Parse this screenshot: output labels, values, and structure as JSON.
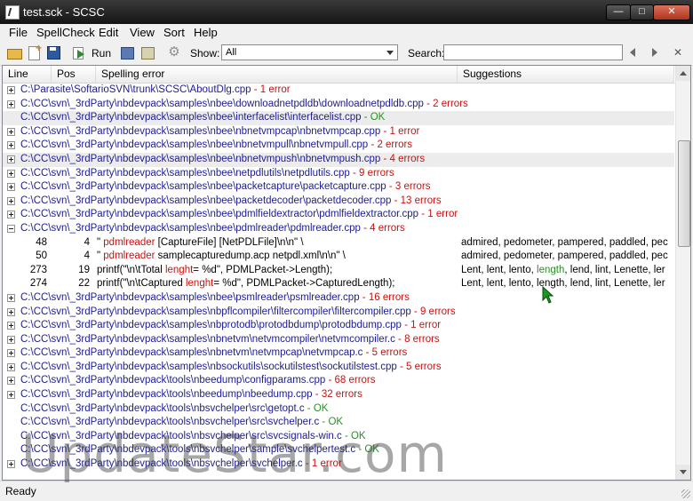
{
  "window": {
    "title": "test.sck - SCSC"
  },
  "menu": [
    "File",
    "SpellCheck",
    "Edit",
    "View",
    "Sort",
    "Help"
  ],
  "toolbar": {
    "run_label": "Run",
    "show_label": "Show:",
    "show_value": "All",
    "search_label": "Search:",
    "search_value": ""
  },
  "columns": {
    "line": "Line",
    "pos": "Pos",
    "error": "Spelling error",
    "suggestions": "Suggestions"
  },
  "rows": [
    {
      "kind": "file",
      "expander": "plus",
      "path": "C:\\Parasite\\SoftarioSVN\\trunk\\SCSC\\AboutDlg.cpp",
      "status": " - 1 error",
      "ok": false
    },
    {
      "kind": "file",
      "expander": "plus",
      "path": "C:\\CC\\svn\\_3rdParty\\nbdevpack\\samples\\nbee\\downloadnetpdldb\\downloadnetpdldb.cpp",
      "status": " - 2 errors",
      "ok": false
    },
    {
      "kind": "file",
      "expander": "none",
      "path": "C:\\CC\\svn\\_3rdParty\\nbdevpack\\samples\\nbee\\interfacelist\\interfacelist.cpp",
      "status": " - OK",
      "ok": true,
      "selected": true
    },
    {
      "kind": "file",
      "expander": "plus",
      "path": "C:\\CC\\svn\\_3rdParty\\nbdevpack\\samples\\nbee\\nbnetvmpcap\\nbnetvmpcap.cpp",
      "status": " - 1 error",
      "ok": false
    },
    {
      "kind": "file",
      "expander": "plus",
      "path": "C:\\CC\\svn\\_3rdParty\\nbdevpack\\samples\\nbee\\nbnetvmpull\\nbnetvmpull.cpp",
      "status": " - 2 errors",
      "ok": false
    },
    {
      "kind": "file",
      "expander": "plus",
      "path": "C:\\CC\\svn\\_3rdParty\\nbdevpack\\samples\\nbee\\nbnetvmpush\\nbnetvmpush.cpp",
      "status": " - 4 errors",
      "ok": false,
      "selected": true
    },
    {
      "kind": "file",
      "expander": "plus",
      "path": "C:\\CC\\svn\\_3rdParty\\nbdevpack\\samples\\nbee\\netpdlutils\\netpdlutils.cpp",
      "status": " - 9 errors",
      "ok": false
    },
    {
      "kind": "file",
      "expander": "plus",
      "path": "C:\\CC\\svn\\_3rdParty\\nbdevpack\\samples\\nbee\\packetcapture\\packetcapture.cpp",
      "status": " - 3 errors",
      "ok": false
    },
    {
      "kind": "file",
      "expander": "plus",
      "path": "C:\\CC\\svn\\_3rdParty\\nbdevpack\\samples\\nbee\\packetdecoder\\packetdecoder.cpp",
      "status": " - 13 errors",
      "ok": false
    },
    {
      "kind": "file",
      "expander": "plus",
      "path": "C:\\CC\\svn\\_3rdParty\\nbdevpack\\samples\\nbee\\pdmlfieldextractor\\pdmlfieldextractor.cpp",
      "status": " - 1 error",
      "ok": false
    },
    {
      "kind": "file",
      "expander": "minus",
      "path": "C:\\CC\\svn\\_3rdParty\\nbdevpack\\samples\\nbee\\pdmlreader\\pdmlreader.cpp",
      "status": " - 4 errors",
      "ok": false
    },
    {
      "kind": "error",
      "line": "48",
      "pos": "4",
      "pre": "\"  ",
      "word": "pdmlreader",
      "post": " [CaptureFile] [NetPDLFile]\\n\\n\" \\",
      "sugg_pre": "admired, pedometer, pampered, paddled, pec",
      "sugg_hl": "",
      "sugg_post": ""
    },
    {
      "kind": "error",
      "line": "50",
      "pos": "4",
      "pre": "\"  ",
      "word": "pdmlreader",
      "post": " samplecapturedump.acp netpdl.xml\\n\\n\"  \\",
      "sugg_pre": "admired, pedometer, pampered, paddled, pec",
      "sugg_hl": "",
      "sugg_post": ""
    },
    {
      "kind": "error",
      "line": "273",
      "pos": "19",
      "pre": "printf(\"\\n\\tTotal ",
      "word": "lenght",
      "post": "= %d\", PDMLPacket->Length);",
      "sugg_pre": "Lent, lent, lento, ",
      "sugg_hl": "length",
      "sugg_post": ", lend, lint, Lenette, ler"
    },
    {
      "kind": "error",
      "line": "274",
      "pos": "22",
      "pre": "printf(\"\\n\\tCaptured ",
      "word": "lenght",
      "post": "= %d\", PDMLPacket->CapturedLength);",
      "sugg_pre": "Lent, lent, lento, length, lend, lint, Lenette, ler",
      "sugg_hl": "",
      "sugg_post": ""
    },
    {
      "kind": "file",
      "expander": "plus",
      "path": "C:\\CC\\svn\\_3rdParty\\nbdevpack\\samples\\nbee\\psmlreader\\psmlreader.cpp",
      "status": " - 16 errors",
      "ok": false
    },
    {
      "kind": "file",
      "expander": "plus",
      "path": "C:\\CC\\svn\\_3rdParty\\nbdevpack\\samples\\nbpflcompiler\\filtercompiler\\filtercompiler.cpp",
      "status": " - 9 errors",
      "ok": false
    },
    {
      "kind": "file",
      "expander": "plus",
      "path": "C:\\CC\\svn\\_3rdParty\\nbdevpack\\samples\\nbprotodb\\protodbdump\\protodbdump.cpp",
      "status": " - 1 error",
      "ok": false
    },
    {
      "kind": "file",
      "expander": "plus",
      "path": "C:\\CC\\svn\\_3rdParty\\nbdevpack\\samples\\nbnetvm\\netvmcompiler\\netvmcompiler.c",
      "status": " - 8 errors",
      "ok": false
    },
    {
      "kind": "file",
      "expander": "plus",
      "path": "C:\\CC\\svn\\_3rdParty\\nbdevpack\\samples\\nbnetvm\\netvmpcap\\netvmpcap.c",
      "status": " - 5 errors",
      "ok": false
    },
    {
      "kind": "file",
      "expander": "plus",
      "path": "C:\\CC\\svn\\_3rdParty\\nbdevpack\\samples\\nbsockutils\\sockutilstest\\sockutilstest.cpp",
      "status": " - 5 errors",
      "ok": false
    },
    {
      "kind": "file",
      "expander": "plus",
      "path": "C:\\CC\\svn\\_3rdParty\\nbdevpack\\tools\\nbeedump\\configparams.cpp",
      "status": " - 68 errors",
      "ok": false
    },
    {
      "kind": "file",
      "expander": "plus",
      "path": "C:\\CC\\svn\\_3rdParty\\nbdevpack\\tools\\nbeedump\\nbeedump.cpp",
      "status": " - 32 errors",
      "ok": false
    },
    {
      "kind": "file",
      "expander": "none",
      "path": "C:\\CC\\svn\\_3rdParty\\nbdevpack\\tools\\nbsvchelper\\src\\getopt.c",
      "status": " - OK",
      "ok": true
    },
    {
      "kind": "file",
      "expander": "none",
      "path": "C:\\CC\\svn\\_3rdParty\\nbdevpack\\tools\\nbsvchelper\\src\\svchelper.c",
      "status": " - OK",
      "ok": true
    },
    {
      "kind": "file",
      "expander": "none",
      "path": "C:\\CC\\svn\\_3rdParty\\nbdevpack\\tools\\nbsvchelper\\src\\svcsignals-win.c",
      "status": " - OK",
      "ok": true
    },
    {
      "kind": "file",
      "expander": "none",
      "path": "C:\\CC\\svn\\_3rdParty\\nbdevpack\\tools\\nbsvchelper\\sample\\svchelpertest.c",
      "status": " - OK",
      "ok": true
    },
    {
      "kind": "file",
      "expander": "plus",
      "path": "C:\\CC\\svn\\_3rdParty\\nbdevpack\\tools\\nbsvchelper\\svchelper.c",
      "status": " - 1 error",
      "ok": false
    }
  ],
  "statusbar": {
    "text": "Ready"
  },
  "watermark": "UpdateStar.com",
  "colors": {
    "path": "#1c1c8f",
    "error": "#cc1010",
    "ok": "#2a8f2a",
    "cursor": "#1a9a1a"
  }
}
